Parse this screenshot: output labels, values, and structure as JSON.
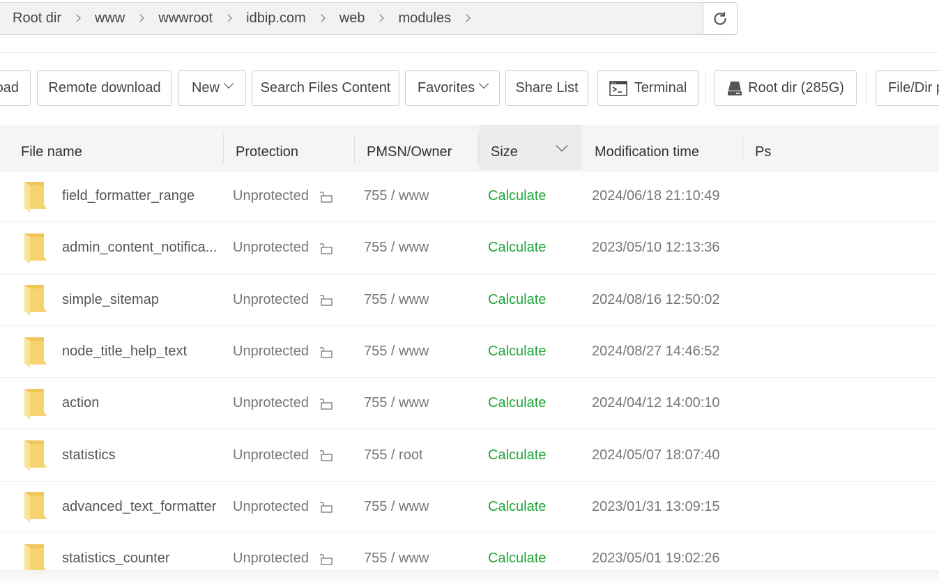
{
  "breadcrumb": {
    "items": [
      "Root dir",
      "www",
      "wwwroot",
      "idbip.com",
      "web",
      "modules"
    ],
    "refresh_icon": "refresh-icon"
  },
  "toolbar": {
    "buttons": [
      {
        "label": "oad",
        "full_label": "Upload",
        "icon": null,
        "dropdown": false
      },
      {
        "label": "Remote download",
        "icon": null,
        "dropdown": false
      },
      {
        "label": "New",
        "icon": null,
        "dropdown": true
      },
      {
        "label": "Search Files Content",
        "icon": null,
        "dropdown": false
      },
      {
        "label": "Favorites",
        "icon": null,
        "dropdown": true
      },
      {
        "label": "Share List",
        "icon": null,
        "dropdown": false
      },
      {
        "label": "Terminal",
        "icon": "terminal-icon",
        "dropdown": false
      },
      {
        "label": "Root dir (285G)",
        "icon": "disk-icon",
        "dropdown": false
      },
      {
        "label": "File/Dir p",
        "icon": null,
        "dropdown": false
      }
    ]
  },
  "table": {
    "columns": [
      "File name",
      "Protection",
      "PMSN/Owner",
      "Size",
      "Modification time",
      "Ps"
    ],
    "sorted_column": "Size",
    "rows": [
      {
        "name": "field_formatter_range",
        "protection": "Unprotected",
        "owner": "755 / www",
        "size": "Calculate",
        "mtime": "2024/06/18 21:10:49"
      },
      {
        "name": "admin_content_notifica...",
        "protection": "Unprotected",
        "owner": "755 / www",
        "size": "Calculate",
        "mtime": "2023/05/10 12:13:36"
      },
      {
        "name": "simple_sitemap",
        "protection": "Unprotected",
        "owner": "755 / www",
        "size": "Calculate",
        "mtime": "2024/08/16 12:50:02"
      },
      {
        "name": "node_title_help_text",
        "protection": "Unprotected",
        "owner": "755 / www",
        "size": "Calculate",
        "mtime": "2024/08/27 14:46:52"
      },
      {
        "name": "action",
        "protection": "Unprotected",
        "owner": "755 / www",
        "size": "Calculate",
        "mtime": "2024/04/12 14:00:10"
      },
      {
        "name": "statistics",
        "protection": "Unprotected",
        "owner": "755 / root",
        "size": "Calculate",
        "mtime": "2024/05/07 18:07:40"
      },
      {
        "name": "advanced_text_formatter",
        "protection": "Unprotected",
        "owner": "755 / www",
        "size": "Calculate",
        "mtime": "2023/01/31 13:09:15"
      },
      {
        "name": "statistics_counter",
        "protection": "Unprotected",
        "owner": "755 / www",
        "size": "Calculate",
        "mtime": "2023/05/01 19:02:26"
      }
    ]
  },
  "colors": {
    "calculate_link": "#20a53a",
    "folder": "#f5d36e",
    "header_bg": "#f5f5f5"
  }
}
